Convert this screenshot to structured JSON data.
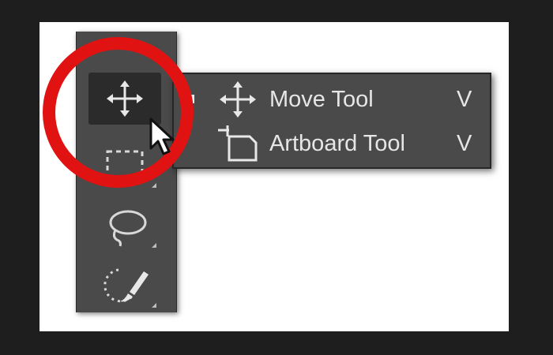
{
  "toolbar": {
    "tools": [
      {
        "name": "Move Tool",
        "icon": "move-icon",
        "active": true
      },
      {
        "name": "Rectangular Marquee Tool",
        "icon": "marquee-icon"
      },
      {
        "name": "Lasso Tool",
        "icon": "lasso-icon"
      },
      {
        "name": "Quick Selection Tool",
        "icon": "quick-selection-icon"
      }
    ]
  },
  "flyout": {
    "items": [
      {
        "label": "Move Tool",
        "shortcut": "V",
        "icon": "move-icon",
        "selected": true
      },
      {
        "label": "Artboard Tool",
        "shortcut": "V",
        "icon": "artboard-icon",
        "selected": false
      }
    ]
  },
  "colors": {
    "highlight_circle": "#e11212",
    "panel": "#4a4a4a",
    "active_tool": "#2b2b2b"
  }
}
